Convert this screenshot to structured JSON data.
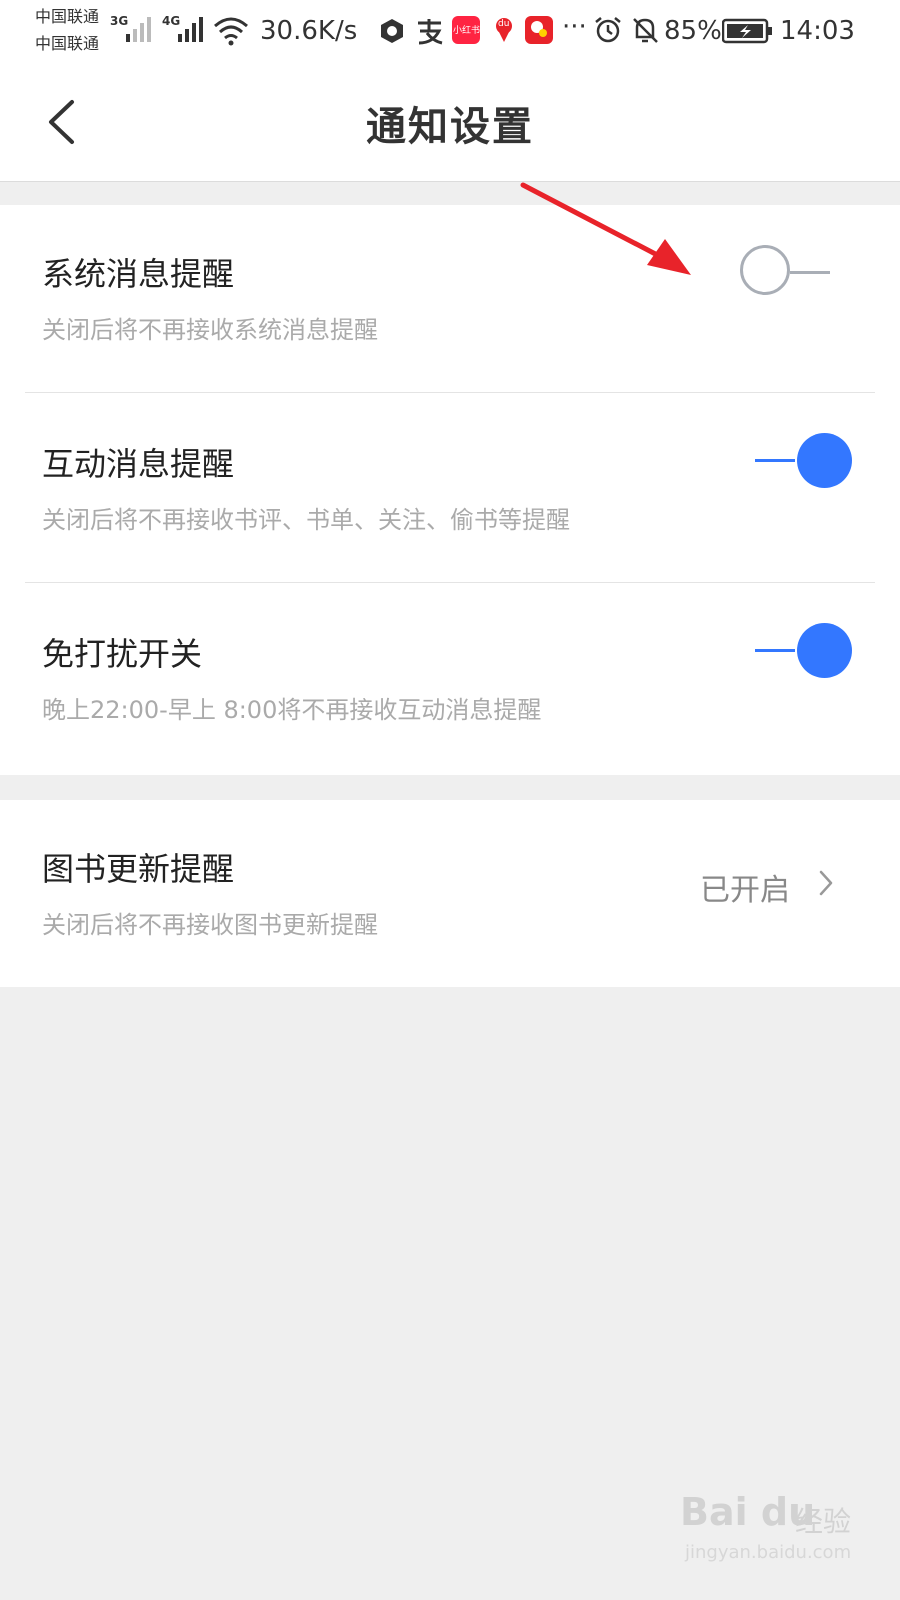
{
  "status_bar": {
    "carrier_1": "中国联通",
    "carrier_2": "中国联通",
    "network_1": "3G",
    "network_2": "4G",
    "speed": "30.6K/s",
    "battery": "85%",
    "time": "14:03",
    "more": "···",
    "app_label_xhs": "小红书",
    "app_label_maps": "du",
    "icons": [
      "signal-3g-icon",
      "signal-4g-icon",
      "wifi-icon",
      "vpn-icon",
      "alipay-icon",
      "xiaohongshu-icon",
      "baidu-maps-icon",
      "red-app-icon",
      "more-icon",
      "alarm-icon",
      "mute-icon",
      "battery-charging-icon"
    ]
  },
  "header": {
    "title": "通知设置",
    "back_icon": "chevron-left-icon"
  },
  "settings": {
    "system_msg": {
      "title": "系统消息提醒",
      "desc": "关闭后将不再接收系统消息提醒",
      "enabled": false
    },
    "interact_msg": {
      "title": "互动消息提醒",
      "desc": "关闭后将不再接收书评、书单、关注、偷书等提醒",
      "enabled": true
    },
    "dnd": {
      "title": "免打扰开关",
      "desc": "晚上22:00-早上 8:00将不再接收互动消息提醒",
      "enabled": true
    },
    "book_update": {
      "title": "图书更新提醒",
      "desc": "关闭后将不再接收图书更新提醒",
      "value": "已开启"
    }
  },
  "colors": {
    "accent": "#3377ff",
    "toggle_off": "#a9aeb6",
    "annotation_arrow": "#e8232a",
    "background": "#efefef"
  },
  "watermark": {
    "brand": "Bai du",
    "cn": "经验",
    "url": "jingyan.baidu.com"
  }
}
